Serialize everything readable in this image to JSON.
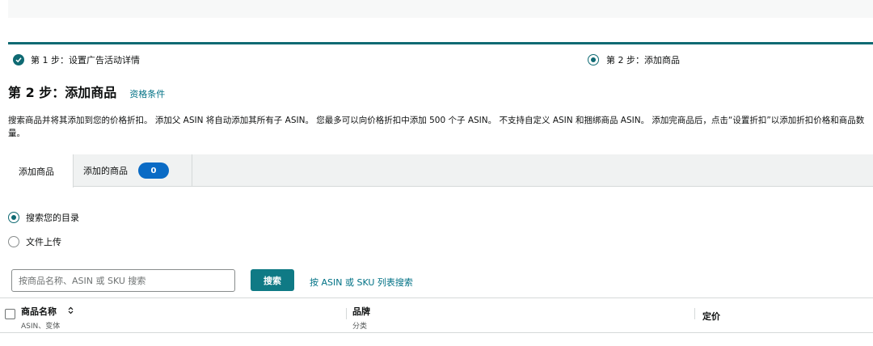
{
  "steps": {
    "step1_label": "第 1 步：设置广告活动详情",
    "step2_label": "第 2 步：添加商品"
  },
  "header": {
    "title": "第 2 步：添加商品",
    "eligibility_link": "资格条件"
  },
  "description": "搜索商品并将其添加到您的价格折扣。 添加父 ASIN 将自动添加其所有子 ASIN。 您最多可以向价格折扣中添加 500 个子 ASIN。 不支持自定义 ASIN 和捆绑商品 ASIN。 添加完商品后，点击“设置折扣”以添加折扣价格和商品数量。",
  "tabs": [
    {
      "label": "添加商品",
      "active": true
    },
    {
      "label": "添加的商品",
      "count": "0"
    }
  ],
  "source_options": [
    {
      "label": "搜索您的目录",
      "selected": true
    },
    {
      "label": "文件上传",
      "selected": false
    }
  ],
  "search": {
    "placeholder": "按商品名称、ASIN 或 SKU 搜索",
    "button_label": "搜索",
    "list_link": "按 ASIN 或 SKU 列表搜索"
  },
  "table": {
    "columns": [
      {
        "title": "商品名称",
        "subtitle": "ASIN、变体"
      },
      {
        "title": "品牌",
        "subtitle": "分类"
      },
      {
        "title": "定价",
        "subtitle": ""
      }
    ]
  },
  "colors": {
    "accent": "#0f6a73",
    "link": "#007185",
    "badge": "#0a6bc5"
  }
}
